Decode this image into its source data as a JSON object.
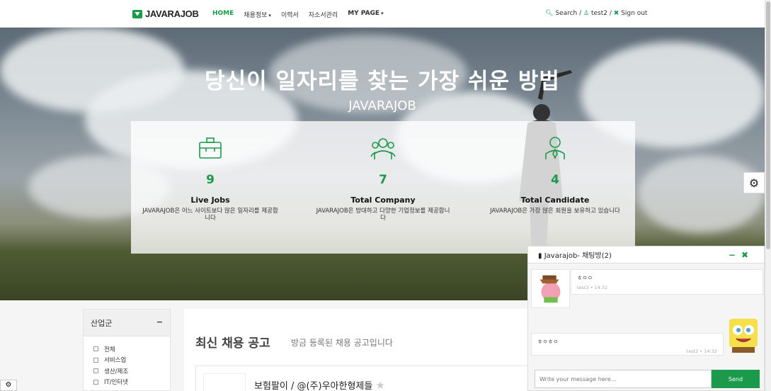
{
  "nav": {
    "logo": "JAVARAJOB",
    "items": [
      {
        "label": "HOME"
      },
      {
        "label": "채용정보",
        "caret": "▾"
      },
      {
        "label": "이력서"
      },
      {
        "label": "자소서관리"
      },
      {
        "label": "MY PAGE",
        "caret": "▾"
      }
    ],
    "search": "Search",
    "user": "test2",
    "signout": "Sign out",
    "sep": "/"
  },
  "hero": {
    "title": "당신이 일자리를 찾는 가장 쉬운 방법",
    "subtitle": "JAVARAJOB",
    "stats": [
      {
        "icon": "briefcase-icon",
        "number": "9",
        "label": "Live Jobs",
        "desc": "JAVARAJOB은 어느 사이트보다 많은 일자리를 제공합니다"
      },
      {
        "icon": "company-icon",
        "number": "7",
        "label": "Total Company",
        "desc": "JAVARAJOB은 방대하고 다양한 기업정보를 제공합니다"
      },
      {
        "icon": "candidate-icon",
        "number": "4",
        "label": "Total Candidate",
        "desc": "JAVARAJOB은 가장 많은 회원을 보유하고 있습니다"
      }
    ]
  },
  "filter": {
    "title": "산업군",
    "toggle": "−",
    "options": [
      "전체",
      "서비스업",
      "생산/제조",
      "IT/인터넷"
    ]
  },
  "jobs": {
    "title": "최신 채용 공고",
    "subtitle": "방금 등록된 채용 공고입니다",
    "first_job": "보험팔이 / @(주)우아한형제들"
  },
  "chat": {
    "title": "Javarajob- 채팅방(2)",
    "messages": [
      {
        "text": "ㅎㅇㅇ",
        "meta": "test3 • 14:32"
      },
      {
        "text": "ㅎㅇㅎㅇ",
        "meta": "test2 • 14:32"
      }
    ],
    "placeholder": "Write your message here...",
    "send": "Send"
  },
  "colors": {
    "accent": "#1a9a4a"
  }
}
